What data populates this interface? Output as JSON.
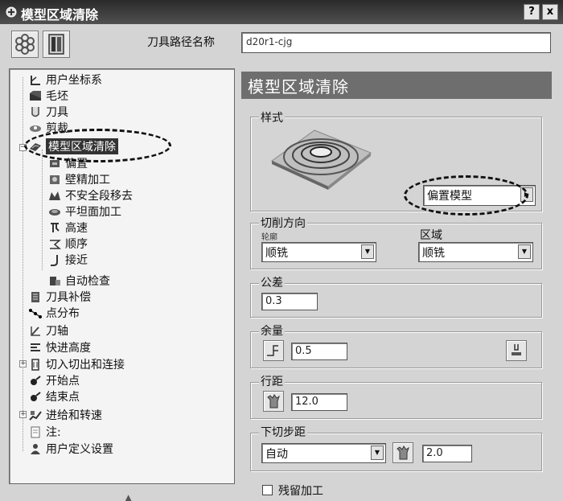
{
  "window": {
    "title": "模型区域清除",
    "help_label": "?",
    "close_label": "x"
  },
  "toolpath": {
    "name_label": "刀具路径名称",
    "name_value": "d20r1-cjg"
  },
  "tree": {
    "items": [
      {
        "label": "用户坐标系",
        "icon": "ucs-icon"
      },
      {
        "label": "毛坯",
        "icon": "block-icon"
      },
      {
        "label": "刀具",
        "icon": "tool-icon"
      },
      {
        "label": "剪裁",
        "icon": "trim-icon"
      },
      {
        "label": "模型区域清除",
        "icon": "strategy-icon"
      },
      {
        "label": "偏置",
        "icon": "offset-icon"
      },
      {
        "label": "壁精加工",
        "icon": "wall-finish-icon"
      },
      {
        "label": "不安全段移去",
        "icon": "unsafe-removal-icon"
      },
      {
        "label": "平坦面加工",
        "icon": "flat-machining-icon"
      },
      {
        "label": "高速",
        "icon": "high-speed-icon"
      },
      {
        "label": "顺序",
        "icon": "order-icon"
      },
      {
        "label": "接近",
        "icon": "approach-icon"
      },
      {
        "label": "自动检查",
        "icon": "auto-check-icon"
      },
      {
        "label": "刀具补偿",
        "icon": "tool-compensation-icon"
      },
      {
        "label": "点分布",
        "icon": "point-distribution-icon"
      },
      {
        "label": "刀轴",
        "icon": "tool-axis-icon"
      },
      {
        "label": "快进高度",
        "icon": "rapid-height-icon"
      },
      {
        "label": "切入切出和连接",
        "icon": "leads-links-icon"
      },
      {
        "label": "开始点",
        "icon": "start-point-icon"
      },
      {
        "label": "结束点",
        "icon": "end-point-icon"
      },
      {
        "label": "进给和转速",
        "icon": "feeds-speeds-icon"
      },
      {
        "label": "注:",
        "icon": "notes-icon"
      },
      {
        "label": "用户定义设置",
        "icon": "user-settings-icon"
      }
    ]
  },
  "panel": {
    "header": "模型区域清除",
    "style_group": {
      "label": "样式",
      "value": "偏置模型"
    },
    "cut_direction": {
      "label": "切削方向",
      "profile_label": "轮廓",
      "profile_value": "顺铣",
      "area_label": "区域",
      "area_value": "顺铣"
    },
    "tolerance": {
      "label": "公差",
      "value": "0.3"
    },
    "allowance": {
      "label": "余量",
      "value": "0.5"
    },
    "stepover": {
      "label": "行距",
      "value": "12.0"
    },
    "stepdown": {
      "label": "下切步距",
      "mode": "自动",
      "value": "2.0"
    },
    "rest_machining": {
      "label": "残留加工",
      "checked": false
    }
  }
}
